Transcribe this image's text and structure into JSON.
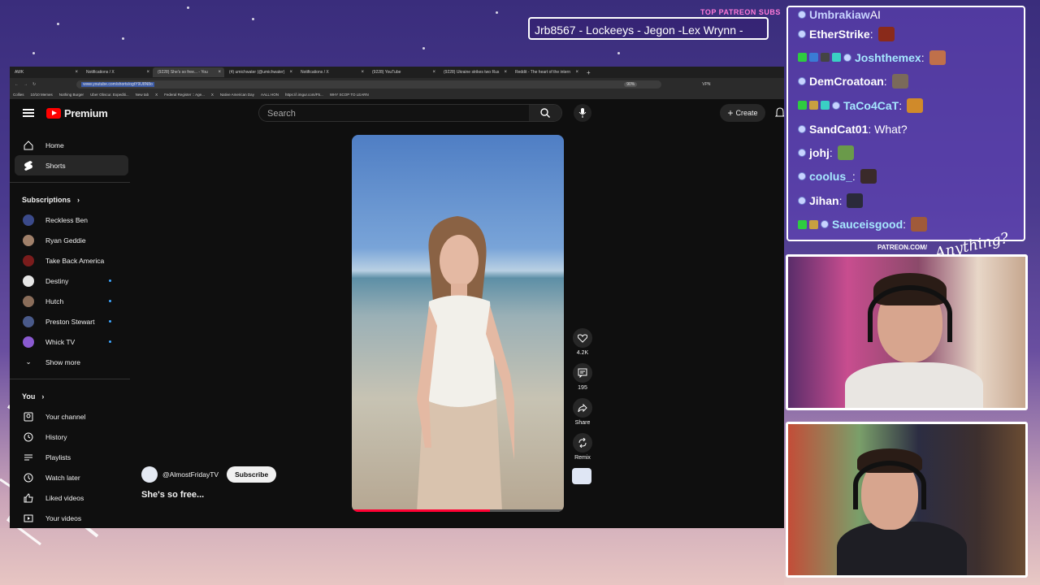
{
  "overlay": {
    "top_subs_title": "TOP PATREON SUBS",
    "top_subs_names": "Jrb8567 - Lockeeys - Jegon -Lex Wrynn -",
    "patreon_url": "PATREON.COM/",
    "brand": "Anything?"
  },
  "browser": {
    "tabs": [
      {
        "label": "AWK"
      },
      {
        "label": "Notifications / X"
      },
      {
        "label": "(9228) She's so free... - You"
      },
      {
        "label": "(4) umichwater (@umichwater)"
      },
      {
        "label": "Notifications / X"
      },
      {
        "label": "(9228) YouTube"
      },
      {
        "label": "(9228) Ukraine strikes two Rus"
      },
      {
        "label": "Reddit - The heart of the intern"
      }
    ],
    "url": "www.youtube.com/shorts/ogtY9U8N8o",
    "zoom": "90%",
    "vpn": "VPN",
    "bookmarks": [
      "Collies",
      "10/10 Memes",
      "Nothing Burger",
      "Uber Obscur. Expediti...",
      "New tab",
      "X",
      "Federal Register :: Age...",
      "X",
      "Native American Day",
      "AALL HON",
      "https://i.imgur.com/F5...",
      "WHY SCOP TO LEARN"
    ]
  },
  "youtube": {
    "logo_text": "Premium",
    "search_placeholder": "Search",
    "create_label": "Create",
    "nav": [
      {
        "label": "Home"
      },
      {
        "label": "Shorts"
      }
    ],
    "subscriptions_header": "Subscriptions",
    "subscriptions": [
      {
        "label": "Reckless Ben",
        "color": "#3b4a8a",
        "new": false
      },
      {
        "label": "Ryan Geddie",
        "color": "#a0806a",
        "new": false
      },
      {
        "label": "Take Back America",
        "color": "#7a1c1c",
        "new": false
      },
      {
        "label": "Destiny",
        "color": "#e6e6e6",
        "new": true
      },
      {
        "label": "Hutch",
        "color": "#8a6d5a",
        "new": true
      },
      {
        "label": "Preston Stewart",
        "color": "#4a5a8a",
        "new": true
      },
      {
        "label": "Whick TV",
        "color": "#8a5ad0",
        "new": true
      }
    ],
    "show_more": "Show more",
    "you_header": "You",
    "you_items": [
      {
        "label": "Your channel",
        "icon": "channel-icon"
      },
      {
        "label": "History",
        "icon": "history-icon"
      },
      {
        "label": "Playlists",
        "icon": "playlists-icon"
      },
      {
        "label": "Watch later",
        "icon": "clock-icon"
      },
      {
        "label": "Liked videos",
        "icon": "like-icon"
      },
      {
        "label": "Your videos",
        "icon": "video-icon"
      }
    ],
    "short": {
      "channel": "@AlmostFridayTV",
      "subscribe_label": "Subscribe",
      "title": "She's so free...",
      "likes": "4.2K",
      "comments": "195",
      "share_label": "Share",
      "remix_label": "Remix",
      "progress": 0.65
    }
  },
  "chat": {
    "messages": [
      {
        "name": "Umbrakiaw",
        "text": "AI",
        "color": "#c7d3ff",
        "badges": [],
        "emote": false
      },
      {
        "name": "EtherStrike",
        "text": ":",
        "color": "#ffffff",
        "badges": [],
        "emote": true,
        "emote_color": "#8a2a1a"
      },
      {
        "name": "Joshthemex",
        "text": ":",
        "color": "#a6e8ff",
        "badges": [
          "#2ecc40",
          "#3a7bd5",
          "#444444",
          "#3ad0c4"
        ],
        "emote": true,
        "emote_color": "#c0704a"
      },
      {
        "name": "DemCroatoan",
        "text": ":",
        "color": "#ffffff",
        "badges": [],
        "emote": true,
        "emote_color": "#7a6a5a"
      },
      {
        "name": "TaCo4CaT",
        "text": ":",
        "color": "#a6e8ff",
        "badges": [
          "#2ecc40",
          "#c8a040",
          "#3ad0c4"
        ],
        "emote": true,
        "emote_color": "#d08a2a"
      },
      {
        "name": "SandCat01",
        "text": ": What?",
        "color": "#ffffff",
        "badges": [],
        "emote": false
      },
      {
        "name": "johj",
        "text": ":",
        "color": "#ffffff",
        "badges": [],
        "emote": true,
        "emote_color": "#6a9a4a"
      },
      {
        "name": "coolus_",
        "text": ":",
        "color": "#a6e8ff",
        "badges": [],
        "emote": true,
        "emote_color": "#3a2a2a"
      },
      {
        "name": "Jihan",
        "text": ":",
        "color": "#ffffff",
        "badges": [],
        "emote": true,
        "emote_color": "#2a2a3a"
      },
      {
        "name": "Sauceisgood",
        "text": ":",
        "color": "#a6e8ff",
        "badges": [
          "#2ecc40",
          "#c8a040"
        ],
        "emote": true,
        "emote_color": "#a05a3a"
      }
    ]
  }
}
